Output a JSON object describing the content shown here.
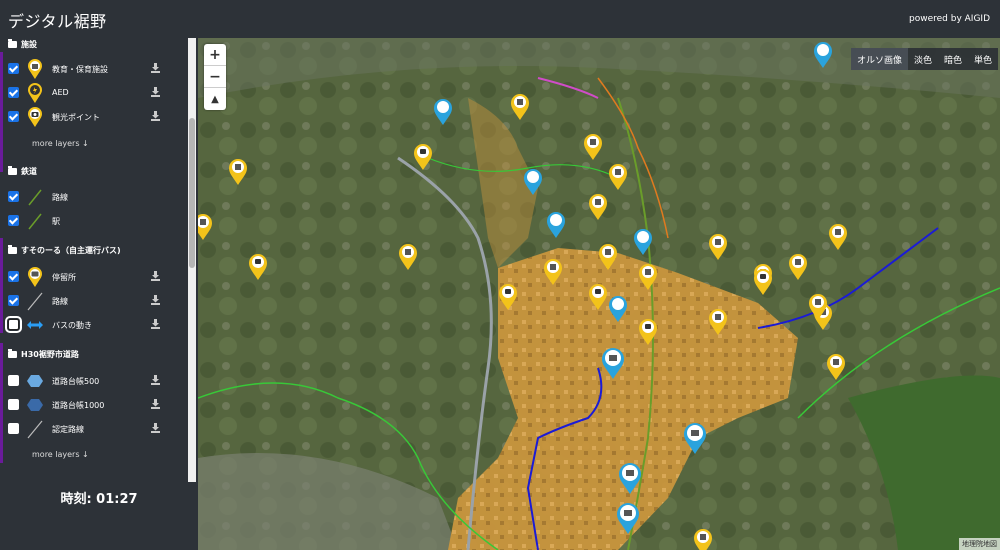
{
  "header": {
    "title": "デジタル裾野",
    "powered": "powered by AIGID"
  },
  "sidebar": {
    "groups": [
      {
        "title": "施設",
        "layers": [
          {
            "label": "教育・保育施設",
            "checked": true,
            "icon": "school-pin-icon"
          },
          {
            "label": "AED",
            "checked": true,
            "icon": "aed-pin-icon"
          },
          {
            "label": "観光ポイント",
            "checked": true,
            "icon": "camera-pin-icon"
          }
        ],
        "more": "more layers ↓"
      },
      {
        "title": "鉄道",
        "layers": [
          {
            "label": "路線",
            "checked": true,
            "icon": "rail-line-icon"
          },
          {
            "label": "駅",
            "checked": true,
            "icon": "station-line-icon"
          }
        ]
      },
      {
        "title": "すそのーる（自主運行バス)",
        "layers": [
          {
            "label": "停留所",
            "checked": true,
            "icon": "bus-stop-pin-icon"
          },
          {
            "label": "路線",
            "checked": true,
            "icon": "bus-line-icon"
          },
          {
            "label": "バスの動き",
            "checked": false,
            "icon": "bus-move-arrow-icon"
          }
        ]
      },
      {
        "title": "H30裾野市道路",
        "layers": [
          {
            "label": "道路台帳500",
            "checked": false,
            "icon": "hexagon-light-icon"
          },
          {
            "label": "道路台帳1000",
            "checked": false,
            "icon": "hexagon-dark-icon"
          },
          {
            "label": "認定路線",
            "checked": false,
            "icon": "road-line-icon"
          }
        ],
        "more": "more layers ↓"
      }
    ],
    "clock": "時刻: 01:27"
  },
  "map": {
    "basemaps": [
      "オルソ画像",
      "淡色",
      "暗色",
      "単色"
    ],
    "active_basemap": "オルソ画像",
    "attribution": "地理院地図",
    "zoom_in": "+",
    "zoom_out": "−",
    "compass": "▲"
  },
  "colors": {
    "urban_area": "#d49b3c",
    "pin_yellow": "#f3c31a",
    "pin_blue": "#2aa3dd",
    "rail_green": "#6a9d2a",
    "road_blue": "#1b1bd6",
    "boundary_green": "#38c838",
    "boundary_pink": "#d04cc8",
    "route_orange": "#e07a1f"
  }
}
